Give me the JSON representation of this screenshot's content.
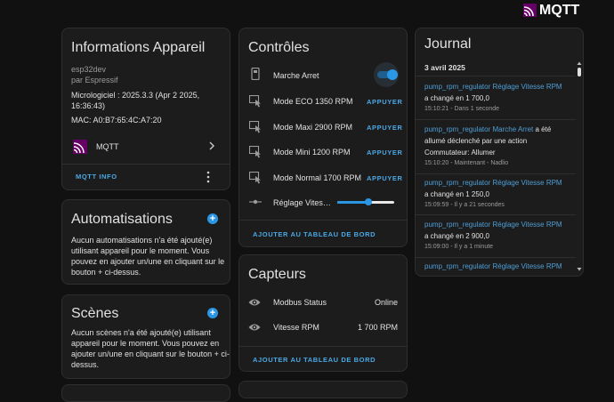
{
  "logo": {
    "text": "MQTT"
  },
  "device_info": {
    "title": "Informations Appareil",
    "model": "esp32dev",
    "manufacturer": "par Espressif",
    "firmware_line1": "Micrologiciel : 2025.3.3 (Apr 2 2025,",
    "firmware_line2": "16:36:43)",
    "mac": "MAC: A0:B7:65:4C:A7:20",
    "integration_label": "MQTT",
    "action_label": "MQTT INFO"
  },
  "automations": {
    "title": "Automatisations",
    "lines": [
      "Aucun automatisations n'a été ajouté(e)",
      "utilisant appareil pour le moment. Vous",
      "pouvez en ajouter un/une en cliquant sur le",
      "bouton + ci-dessus."
    ]
  },
  "scenes": {
    "title": "Scènes",
    "lines": [
      "Aucun scènes n'a été ajouté(e) utilisant",
      "appareil pour le moment. Vous pouvez en",
      "ajouter un/une en cliquant sur le bouton + ci-",
      "dessus."
    ]
  },
  "controls": {
    "title": "Contrôles",
    "switch_label": "Marche Arret",
    "switch_on": true,
    "buttons": [
      {
        "label": "Mode ECO 1350 RPM",
        "action": "APPUYER"
      },
      {
        "label": "Mode Maxi 2900 RPM",
        "action": "APPUYER"
      },
      {
        "label": "Mode Mini 1200 RPM",
        "action": "APPUYER"
      },
      {
        "label": "Mode Normal 1700 RPM",
        "action": "APPUYER"
      }
    ],
    "slider_label": "Réglage Vites…",
    "slider_fraction": 0.55,
    "add_label": "AJOUTER AU TABLEAU DE BORD"
  },
  "sensors": {
    "title": "Capteurs",
    "rows": [
      {
        "label": "Modbus Status",
        "value": "Online"
      },
      {
        "label": "Vitesse RPM",
        "value": "1 700 RPM"
      }
    ],
    "add_label": "AJOUTER AU TABLEAU DE BORD"
  },
  "journal": {
    "title": "Journal",
    "date": "3 avril 2025",
    "entries": [
      {
        "link": "pump_rpm_regulator Réglage Vitesse RPM",
        "text1": "a changé en 1 700,0",
        "text2": "",
        "text3": "",
        "time": "15:10:21 - Dans 1 seconde"
      },
      {
        "link": "pump_rpm_regulator Marche Arret",
        "text1": " a été",
        "text2": "allumé déclenché par une action",
        "text3": "Commutateur: Allumer",
        "time": "15:10:20 - Maintenant - Nadlio"
      },
      {
        "link": "pump_rpm_regulator Réglage Vitesse RPM",
        "text1": "a changé en 1 250,0",
        "text2": "",
        "text3": "",
        "time": "15:09:59 - Il y a 21 secondes"
      },
      {
        "link": "pump_rpm_regulator Réglage Vitesse RPM",
        "text1": "a changé en 2 900,0",
        "text2": "",
        "text3": "",
        "time": "15:09:00 - Il y a 1 minute"
      },
      {
        "link": "pump_rpm_regulator Réglage Vitesse RPM",
        "text1": "",
        "text2": "",
        "text3": "",
        "time": ""
      }
    ]
  },
  "colors": {
    "accent": "#2b96e3",
    "link": "#4f9fd6",
    "mqtt_purple": "#7b1f8f",
    "background": "#111111",
    "card": "#1c1c1c"
  },
  "icons": {
    "logo": "mqtt-logo-icon",
    "switch": "phone-device-icon",
    "button": "gesture-tap-icon",
    "slider": "ray-vertex-icon",
    "sensor": "eye-icon",
    "more": "dots-vertical-icon",
    "chevron": "chevron-right-icon"
  }
}
